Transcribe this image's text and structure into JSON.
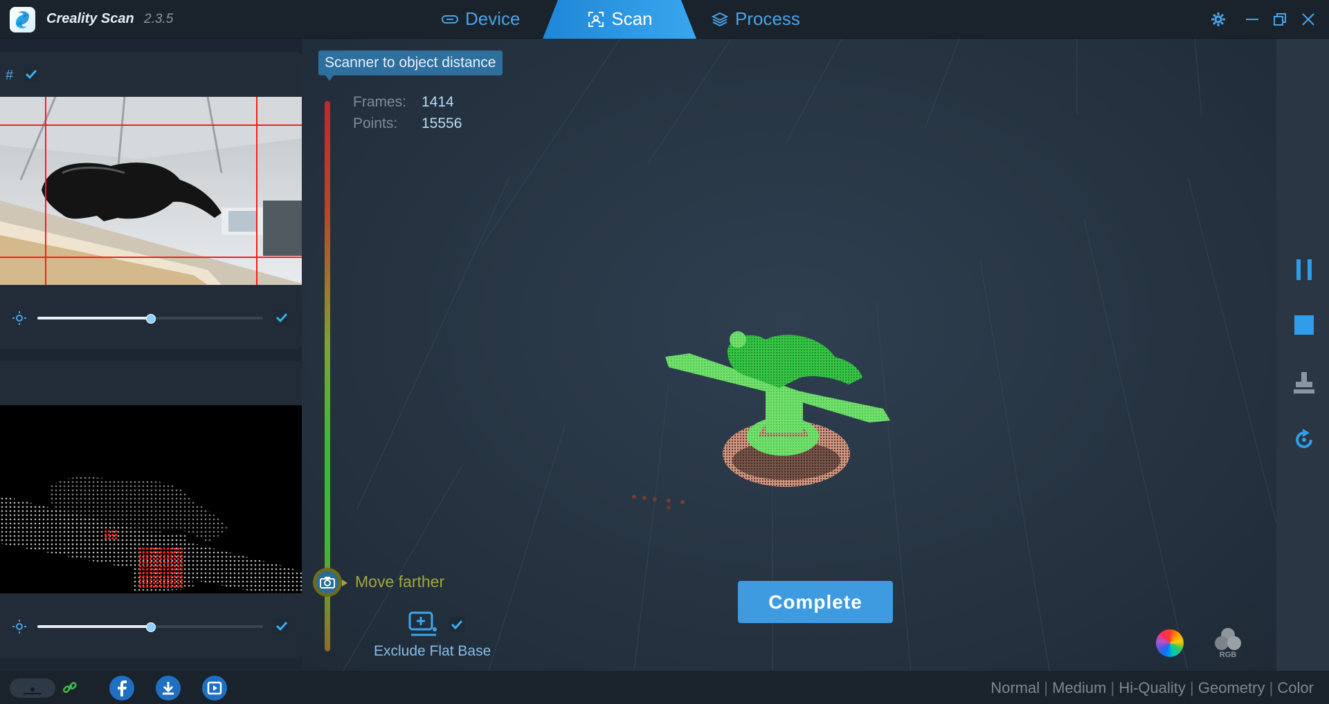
{
  "app": {
    "name": "Creality Scan",
    "version": "2.3.5"
  },
  "tabs": [
    {
      "label": "Device",
      "icon": "device-icon",
      "active": false
    },
    {
      "label": "Scan",
      "icon": "scan-icon",
      "active": true
    },
    {
      "label": "Process",
      "icon": "layers-icon",
      "active": false
    }
  ],
  "window_controls": [
    "gear-icon",
    "minimize-icon",
    "restore-icon",
    "close-icon"
  ],
  "left_panel": {
    "grid_toggle_label": "#",
    "grid_checked": true,
    "color_camera": {
      "brightness": 0.5,
      "enabled": true
    },
    "depth_camera": {
      "brightness": 0.5,
      "enabled": true
    }
  },
  "viewport": {
    "distance_tooltip": "Scanner to object distance",
    "stats": {
      "frames_label": "Frames:",
      "frames_value": "1414",
      "points_label": "Points:",
      "points_value": "15556"
    },
    "distance_hint": "Move farther",
    "exclude_flat_base": {
      "label": "Exclude Flat Base",
      "checked": true
    },
    "complete_button": "Complete",
    "color_mode_icons": [
      "color-wheel-icon",
      "rgb-icon"
    ],
    "rgb_icon_text": "RGB"
  },
  "right_toolbar": [
    "pause-icon",
    "stop-icon",
    "flat-base-icon",
    "reset-view-icon"
  ],
  "statusbar": {
    "quality_modes": [
      "Normal",
      "Medium",
      "Hi-Quality",
      "Geometry",
      "Color"
    ],
    "separator": "|"
  },
  "colors": {
    "accent": "#3e9be0",
    "background": "#1c2632",
    "hint": "#a4a63b",
    "scan_green": "#3fd14a"
  }
}
